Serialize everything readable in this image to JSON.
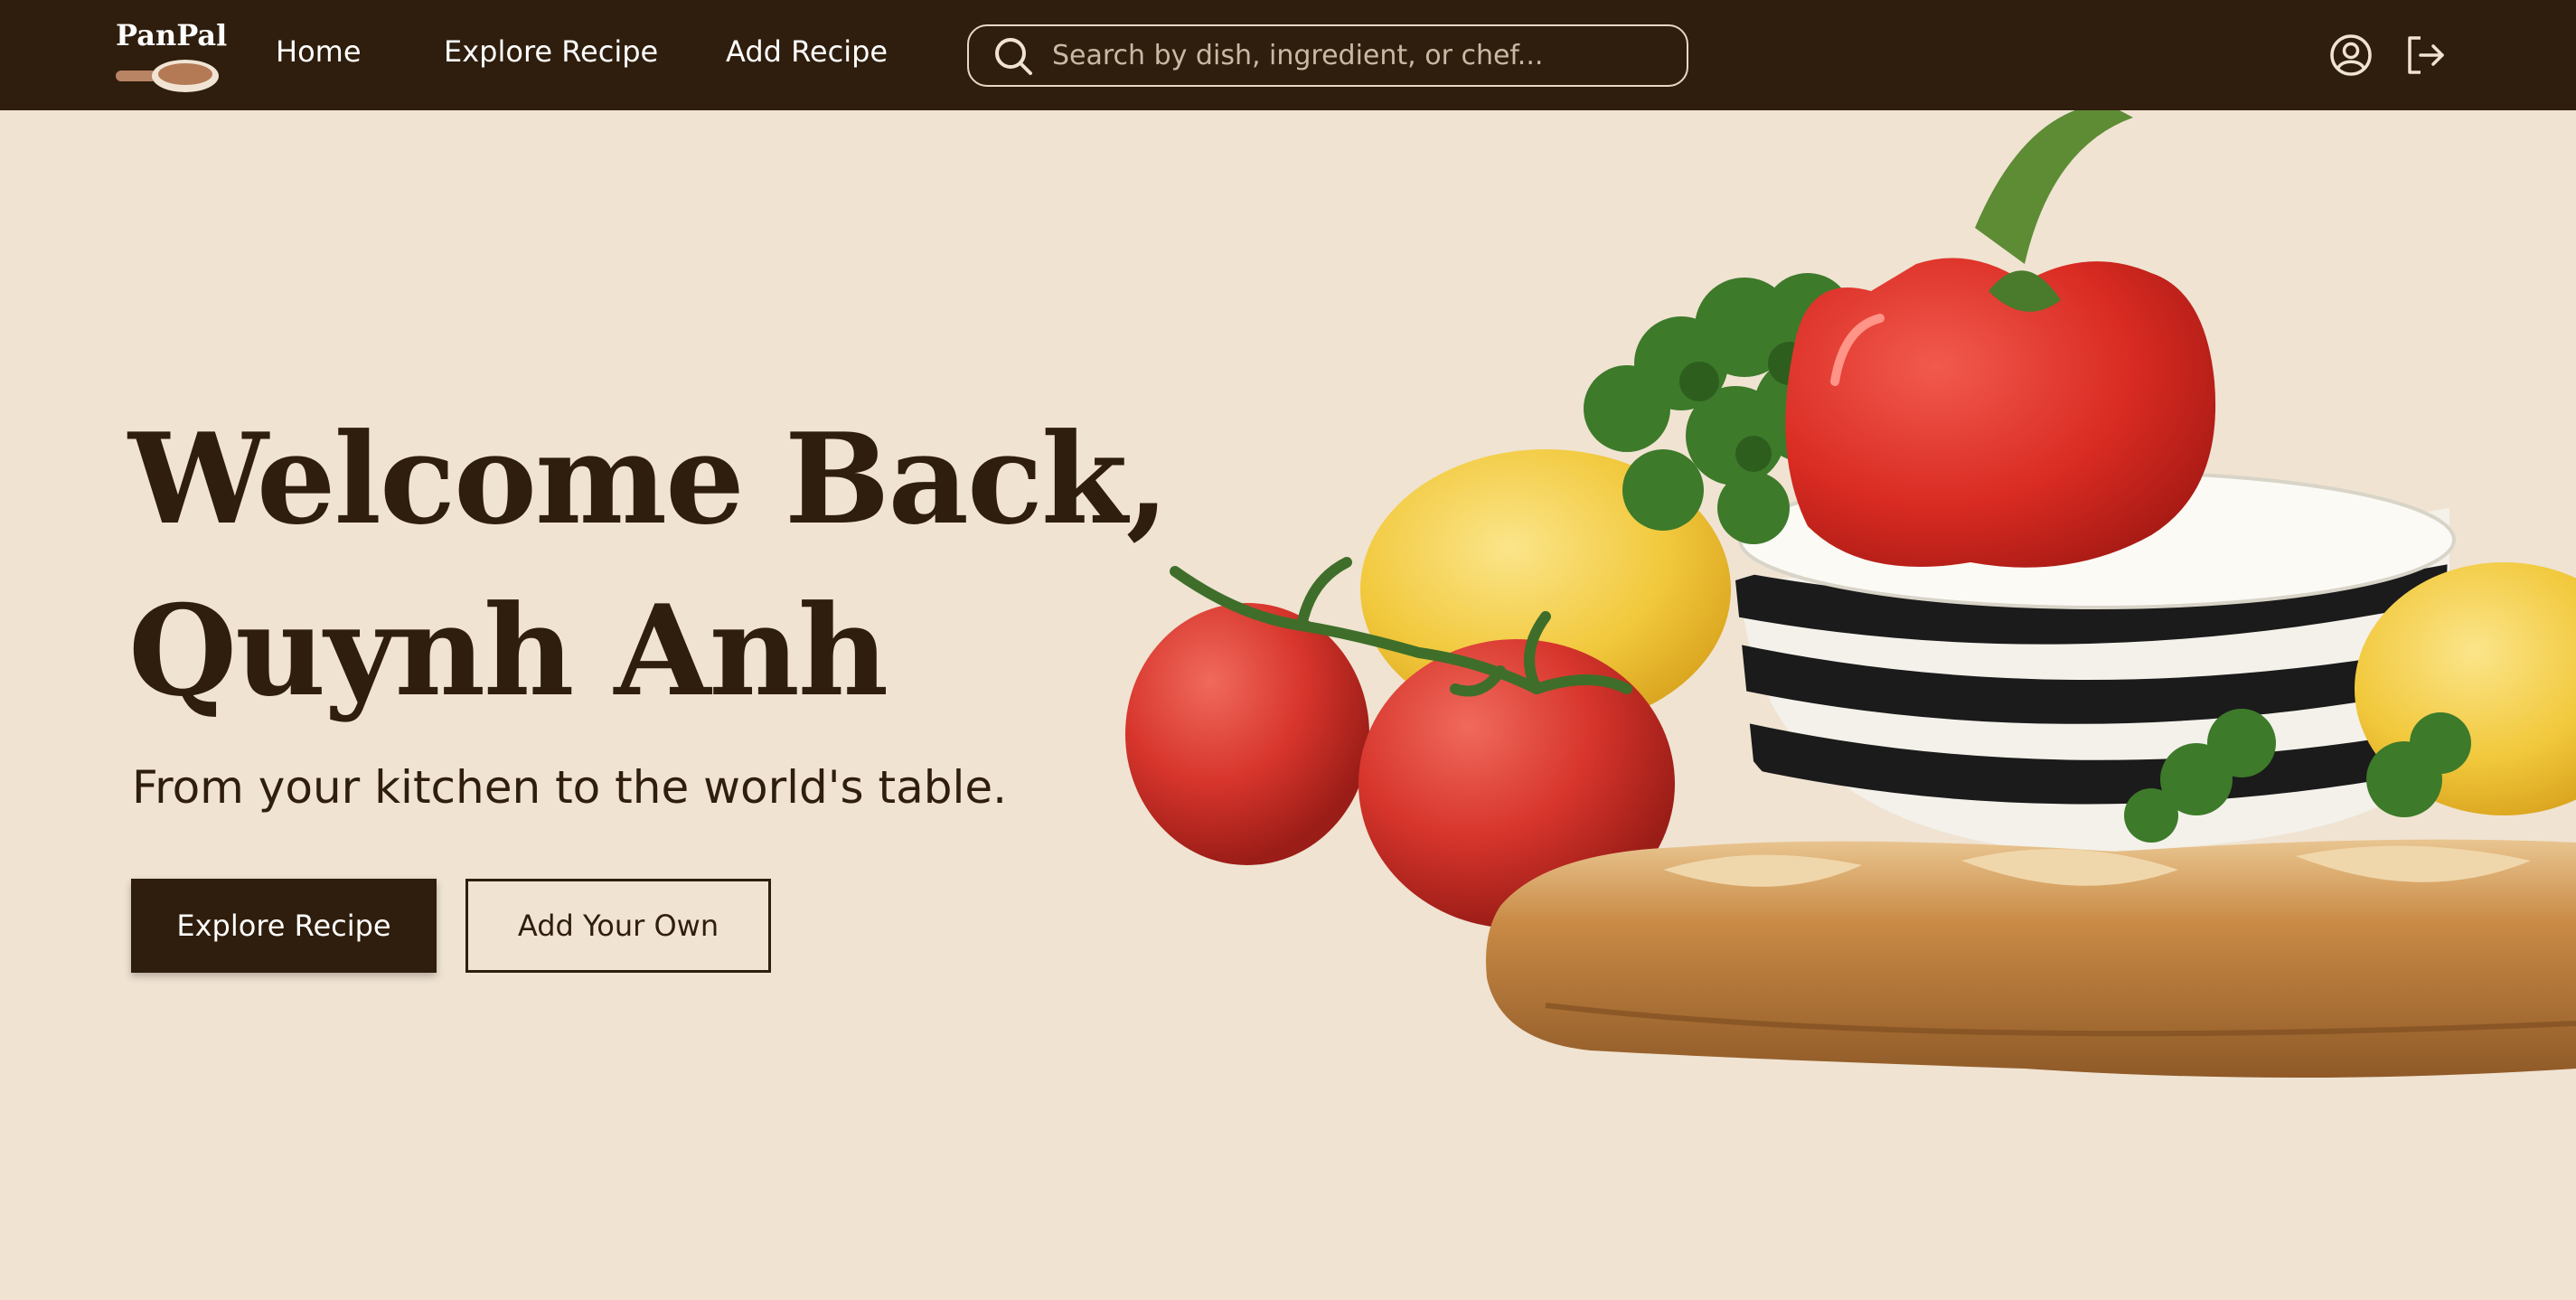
{
  "brand": {
    "name": "PanPal"
  },
  "nav": {
    "links": [
      "Home",
      "Explore Recipe",
      "Add Recipe"
    ],
    "search_placeholder": "Search by dish, ingredient, or chef...",
    "icons": [
      "user-circle-icon",
      "logout-icon"
    ]
  },
  "hero": {
    "title_line1": "Welcome Back,",
    "title_line2": "Quynh Anh",
    "subtitle": "From your kitchen to the world's table.",
    "primary_button": "Explore Recipe",
    "secondary_button": "Add Your Own"
  },
  "colors": {
    "nav_bg": "#2f1e0d",
    "page_bg": "#f0e3d2",
    "primary": "#2f1e0d"
  }
}
